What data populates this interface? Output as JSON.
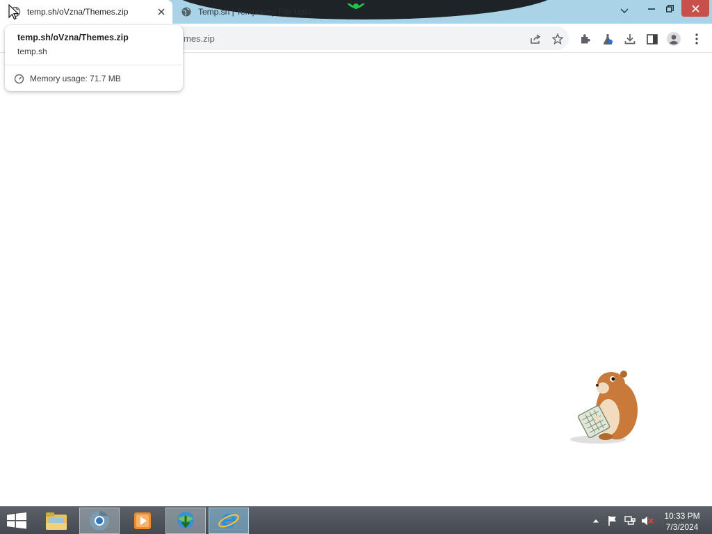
{
  "browser": {
    "tabs": [
      {
        "title": "temp.sh/oVzna/Themes.zip",
        "active": true,
        "favicon": "globe-icon"
      },
      {
        "title": "Temp.sh | Temporary File Uplo",
        "active": false,
        "favicon": "globe-icon"
      }
    ],
    "omnibox": {
      "visible_url": "mes.zip"
    },
    "toolbar_icons": [
      "share-icon",
      "bookmark-star-icon",
      "extensions-icon",
      "labs-flask-icon",
      "download-icon",
      "side-panel-icon",
      "profile-icon",
      "menu-icon"
    ]
  },
  "hover_card": {
    "title": "temp.sh/oVzna/Themes.zip",
    "domain": "temp.sh",
    "memory": "Memory usage: 71.7 MB"
  },
  "taskbar": {
    "apps": [
      "file-explorer-icon",
      "chrome-icon",
      "media-player-icon",
      "download-manager-icon",
      "internet-explorer-icon"
    ],
    "tray_icons": [
      "show-hidden-icons-arrow",
      "action-center-flag-icon",
      "network-icon",
      "volume-muted-icon"
    ],
    "clock": {
      "time": "10:33 PM",
      "date": "7/3/2024"
    }
  },
  "colors": {
    "tabstrip": "#a9d3e7",
    "close_button": "#c7504a",
    "taskbar": "#4d5359"
  }
}
